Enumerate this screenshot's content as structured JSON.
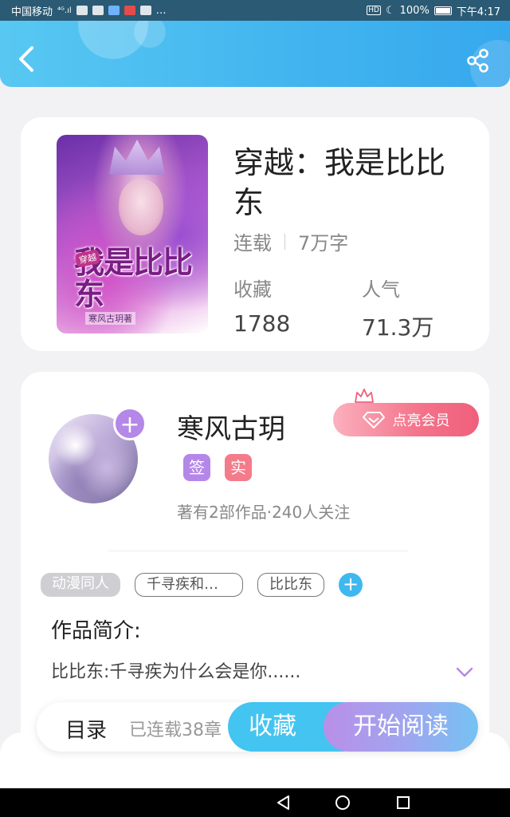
{
  "status_bar": {
    "carrier": "中国移动",
    "signal": "⁴ᴳ.ıl",
    "extra": "…",
    "hd": "HD",
    "battery": "100%",
    "time": "下午4:17"
  },
  "header": {
    "back_icon": "chevron-left-icon",
    "share_icon": "share-icon"
  },
  "book": {
    "title": "穿越：我是比比东",
    "cover": {
      "tag": "穿越",
      "title": "我是比比东",
      "author": "寒风古玥著"
    },
    "status": "连载",
    "word_count": "7万字",
    "favorites_label": "收藏",
    "favorites_value": "1788",
    "popularity_label": "人气",
    "popularity_value": "71.3万"
  },
  "author": {
    "name": "寒风古玥",
    "follow_icon": "plus-icon",
    "vip_label": "点亮会员",
    "badges": {
      "sign": "签",
      "real": "实"
    },
    "stats": "著有2部作品·240人关注"
  },
  "tags": [
    "动漫同人",
    "千寻疾和比比东",
    "比比东"
  ],
  "tag_add": "+",
  "intro": {
    "title": "作品简介:",
    "text": "比比东:千寻疾为什么会是你......"
  },
  "action_bar": {
    "toc_label": "目录",
    "toc_count": "已连载38章",
    "collect_label": "收藏",
    "read_label": "开始阅读"
  },
  "colors": {
    "header": "#41b4ef",
    "accent_purple": "#b487e8",
    "accent_pink": "#f47b8a",
    "accent_blue": "#44c4f0"
  }
}
